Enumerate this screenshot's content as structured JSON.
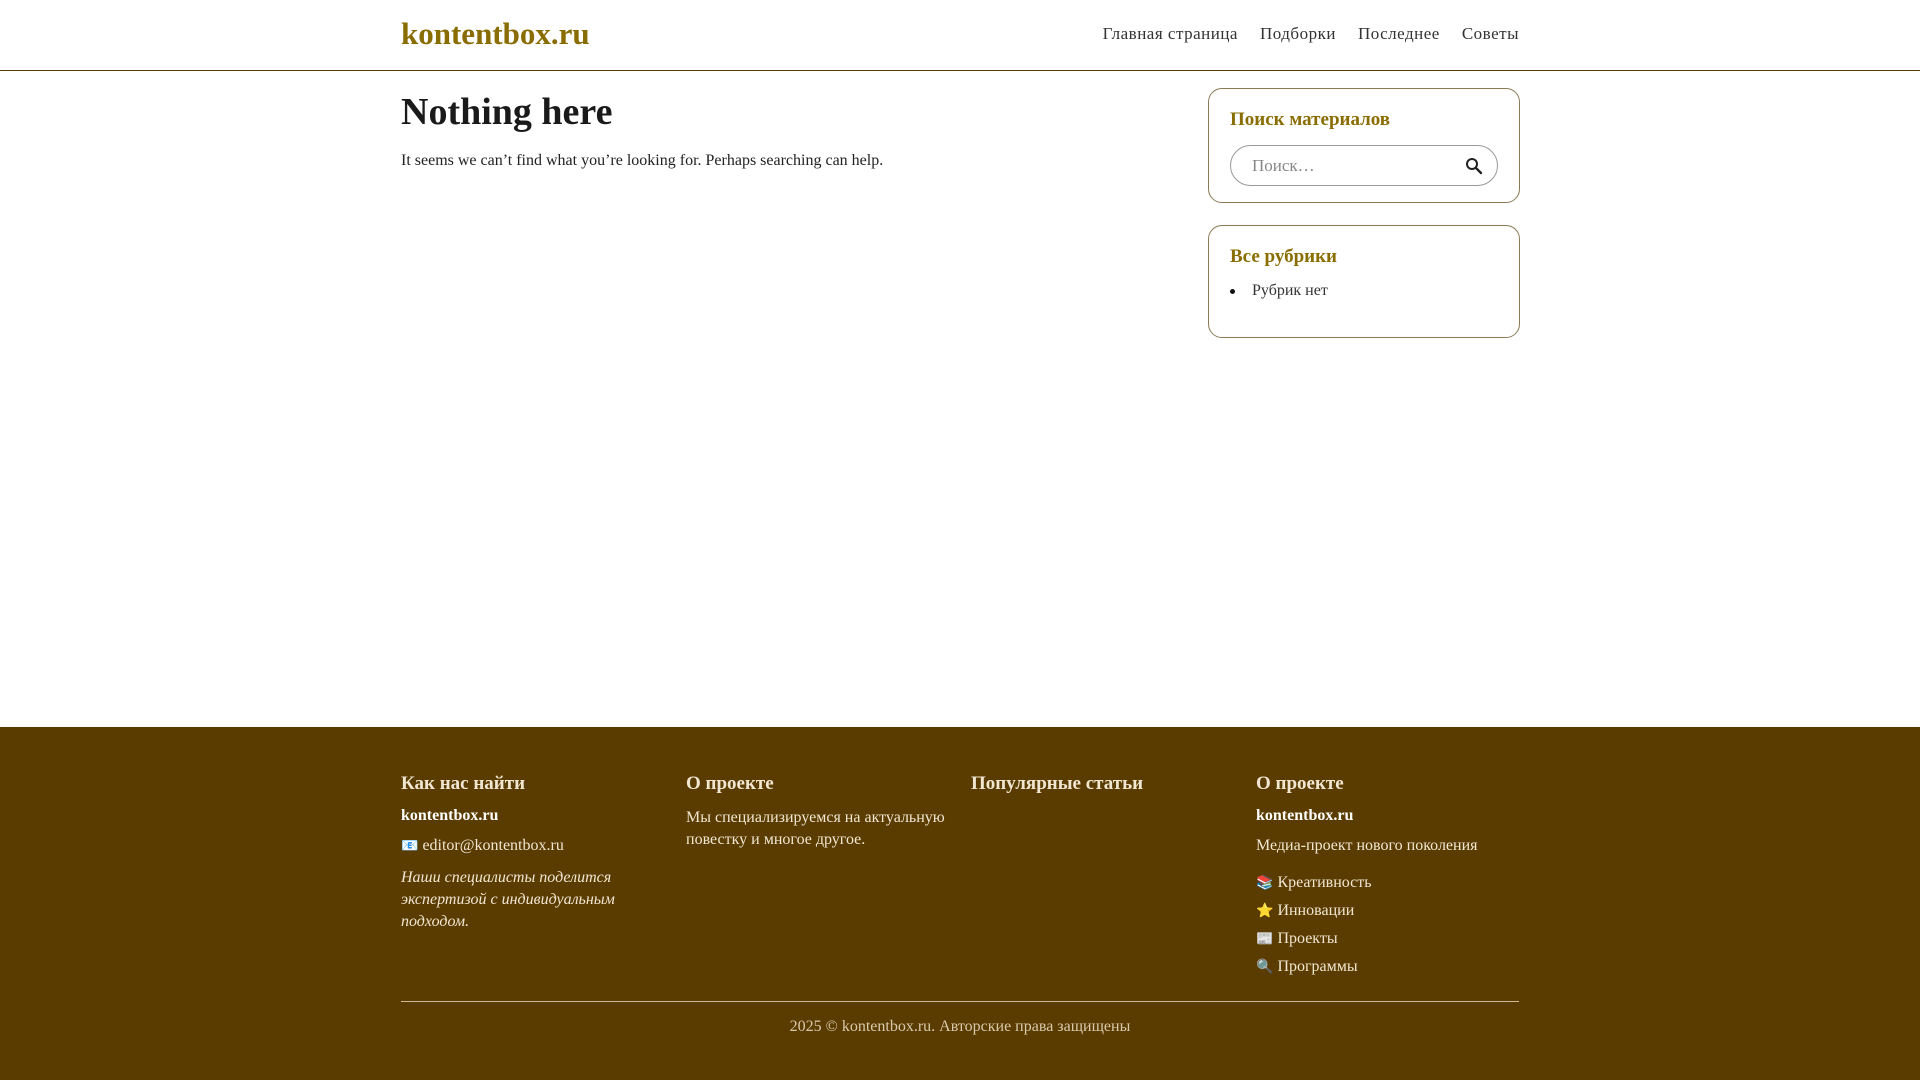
{
  "header": {
    "logo": "kontentbox.ru",
    "nav": [
      "Главная страница",
      "Подборки",
      "Последнее",
      "Советы"
    ]
  },
  "main": {
    "title": "Nothing here",
    "text": "It seems we can’t find what you’re looking for. Perhaps searching can help."
  },
  "sidebar": {
    "search_title": "Поиск материалов",
    "search_placeholder": "Поиск…",
    "cats_title": "Все рубрики",
    "cats": [
      "Рубрик нет"
    ]
  },
  "footer": {
    "col1": {
      "title": "Как нас найти",
      "name": "kontentbox.ru",
      "email_icon": "📧",
      "email": "editor@kontentbox.ru",
      "note": "Наши специалисты поделится экспертизой с индивидуальным подходом."
    },
    "col2": {
      "title": "О проекте",
      "text": "Мы специализируемся на актуальную повестку и многое другое."
    },
    "col3": {
      "title": "Популярные статьи"
    },
    "col4": {
      "title": "О проекте",
      "name": "kontentbox.ru",
      "tagline": "Медиа-проект нового поколения",
      "links": [
        {
          "icon": "📚",
          "label": "Креативность"
        },
        {
          "icon": "⭐",
          "label": "Инновации"
        },
        {
          "icon": "📰",
          "label": "Проекты"
        },
        {
          "icon": "🔍",
          "label": "Программы"
        }
      ]
    },
    "copyright": "2025 © kontentbox.ru. Авторские права защищены"
  },
  "colors": {
    "brand": "#8a6d00",
    "footer_bg": "#5b3c00"
  }
}
